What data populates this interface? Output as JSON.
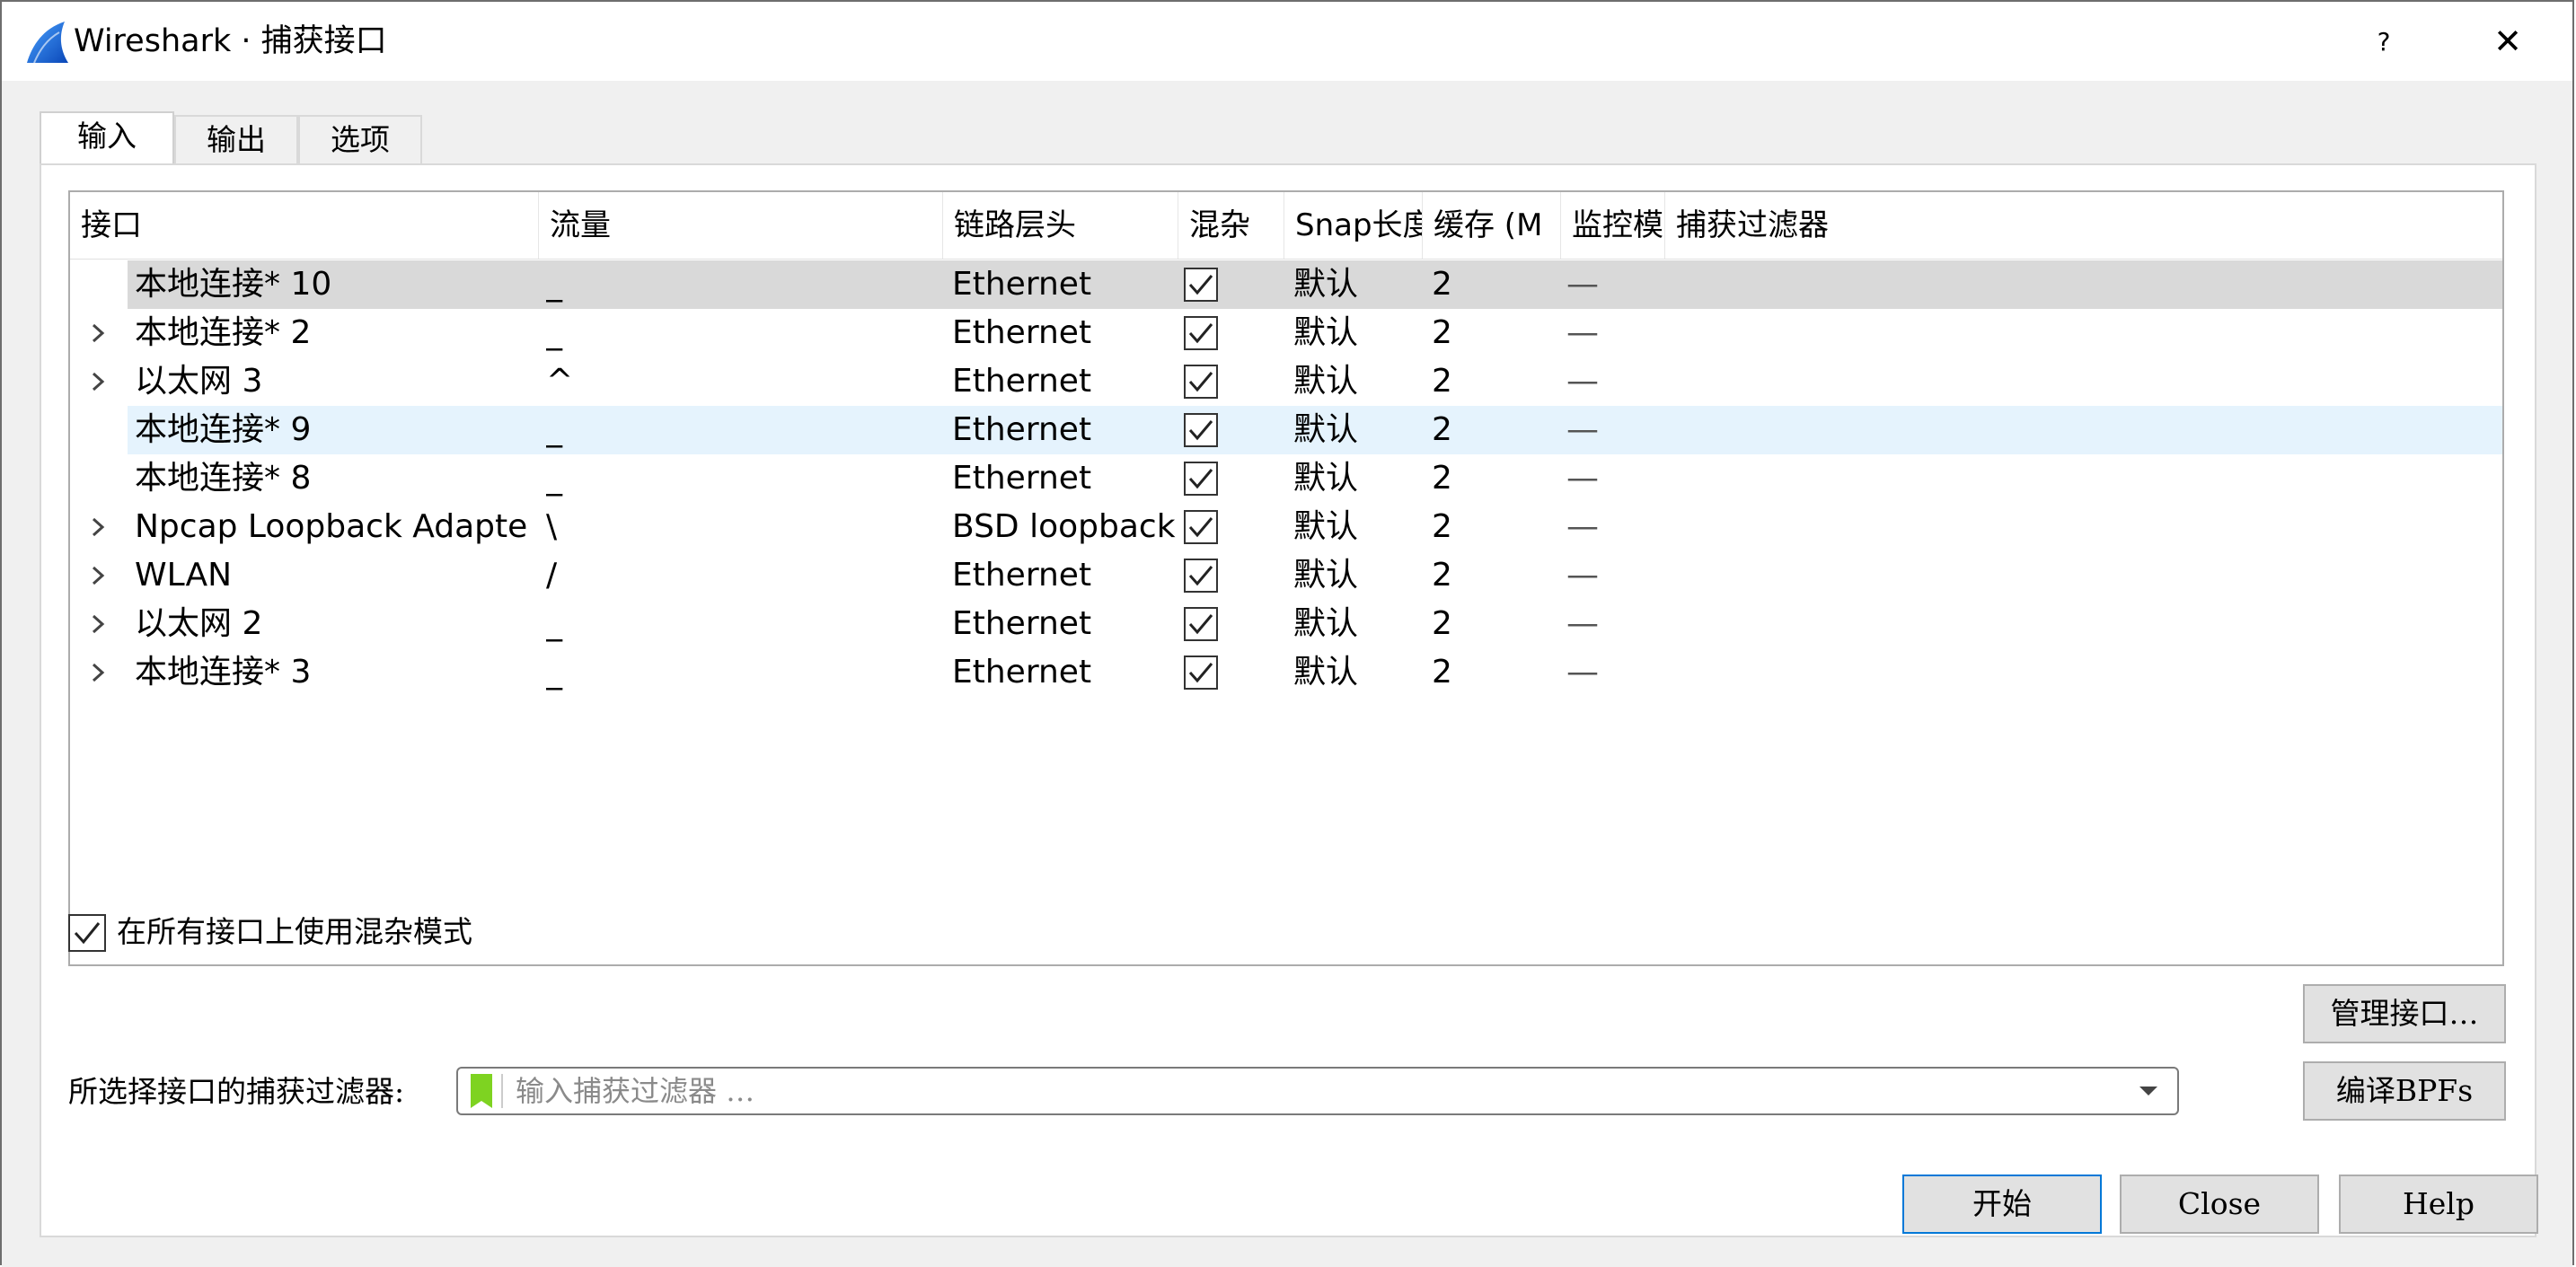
{
  "window": {
    "title": "Wireshark · 捕获接口",
    "help_label": "?",
    "close_label": "✕"
  },
  "tabs": [
    {
      "label": "输入",
      "active": true
    },
    {
      "label": "输出",
      "active": false
    },
    {
      "label": "选项",
      "active": false
    }
  ],
  "table": {
    "columns": [
      "接口",
      "流量",
      "链路层头",
      "混杂",
      "Snap长度",
      "缓存 (M",
      "监控模",
      "捕获过滤器"
    ],
    "rows": [
      {
        "name": "本地连接* 10",
        "traffic": "_",
        "link": "Ethernet",
        "promisc": true,
        "snap": "默认",
        "buffer": "2",
        "monitor": "—",
        "filter": "",
        "expandable": false,
        "state": "selected"
      },
      {
        "name": "本地连接* 2",
        "traffic": "_",
        "link": "Ethernet",
        "promisc": true,
        "snap": "默认",
        "buffer": "2",
        "monitor": "—",
        "filter": "",
        "expandable": true,
        "state": ""
      },
      {
        "name": "以太网 3",
        "traffic": "^",
        "link": "Ethernet",
        "promisc": true,
        "snap": "默认",
        "buffer": "2",
        "monitor": "—",
        "filter": "",
        "expandable": true,
        "state": ""
      },
      {
        "name": "本地连接* 9",
        "traffic": "_",
        "link": "Ethernet",
        "promisc": true,
        "snap": "默认",
        "buffer": "2",
        "monitor": "—",
        "filter": "",
        "expandable": false,
        "state": "hover"
      },
      {
        "name": "本地连接* 8",
        "traffic": "_",
        "link": "Ethernet",
        "promisc": true,
        "snap": "默认",
        "buffer": "2",
        "monitor": "—",
        "filter": "",
        "expandable": false,
        "state": ""
      },
      {
        "name": "Npcap Loopback Adapter",
        "traffic": "\\",
        "link": "BSD loopback",
        "promisc": true,
        "snap": "默认",
        "buffer": "2",
        "monitor": "—",
        "filter": "",
        "expandable": true,
        "state": ""
      },
      {
        "name": "WLAN",
        "traffic": "/",
        "link": "Ethernet",
        "promisc": true,
        "snap": "默认",
        "buffer": "2",
        "monitor": "—",
        "filter": "",
        "expandable": true,
        "state": ""
      },
      {
        "name": "以太网 2",
        "traffic": "_",
        "link": "Ethernet",
        "promisc": true,
        "snap": "默认",
        "buffer": "2",
        "monitor": "—",
        "filter": "",
        "expandable": true,
        "state": ""
      },
      {
        "name": "本地连接* 3",
        "traffic": "_",
        "link": "Ethernet",
        "promisc": true,
        "snap": "默认",
        "buffer": "2",
        "monitor": "—",
        "filter": "",
        "expandable": true,
        "state": ""
      }
    ]
  },
  "options": {
    "promisc_all_label": "在所有接口上使用混杂模式",
    "promisc_all_checked": true,
    "manage_interfaces_label": "管理接口…",
    "filter_label": "所选择接口的捕获过滤器:",
    "filter_placeholder": "输入捕获过滤器 …",
    "compile_bpf_label": "编译BPFs"
  },
  "buttons": {
    "start": "开始",
    "close": "Close",
    "help": "Help"
  },
  "colors": {
    "selected_row": "#d9d9d9",
    "hover_row": "#e5f3fd",
    "bookmark_green": "#7ed321",
    "default_button_border": "#0078d7"
  }
}
